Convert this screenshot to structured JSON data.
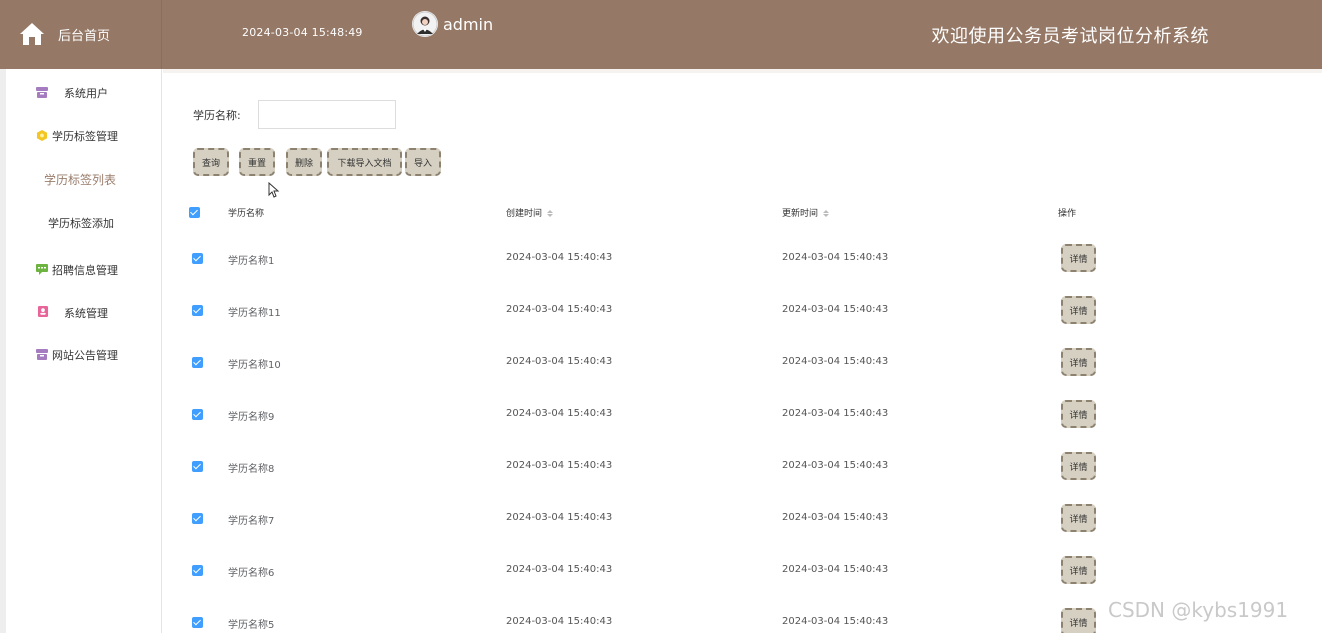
{
  "header": {
    "home_label": "后台首页",
    "datetime": "2024-03-04 15:48:49",
    "username": "admin",
    "welcome": "欢迎使用公务员考试岗位分析系统",
    "bg_color": "#957866"
  },
  "sidebar": {
    "items": [
      {
        "label": "系统用户",
        "icon": "box-icon",
        "icon_color": "#a57cc0"
      },
      {
        "label": "学历标签管理",
        "icon": "hexagon-icon",
        "icon_color": "#f3c623"
      },
      {
        "label": "学历标签列表",
        "sub": true,
        "active": true
      },
      {
        "label": "学历标签添加",
        "sub": true
      },
      {
        "label": "招聘信息管理",
        "icon": "chat-icon",
        "icon_color": "#6db33f"
      },
      {
        "label": "系统管理",
        "icon": "id-card-icon",
        "icon_color": "#e8659a"
      },
      {
        "label": "网站公告管理",
        "icon": "box-icon",
        "icon_color": "#a57cc0"
      }
    ]
  },
  "search": {
    "label": "学历名称:",
    "value": "",
    "placeholder": ""
  },
  "toolbar": {
    "query": "查询",
    "reset": "重置",
    "delete": "删除",
    "download_template": "下载导入文档",
    "import": "导入"
  },
  "table": {
    "columns": {
      "name": "学历名称",
      "created": "创建时间",
      "updated": "更新时间",
      "actions": "操作"
    },
    "detail_label": "详情",
    "rows": [
      {
        "name": "学历名称1",
        "created": "2024-03-04 15:40:43",
        "updated": "2024-03-04 15:40:43"
      },
      {
        "name": "学历名称11",
        "created": "2024-03-04 15:40:43",
        "updated": "2024-03-04 15:40:43"
      },
      {
        "name": "学历名称10",
        "created": "2024-03-04 15:40:43",
        "updated": "2024-03-04 15:40:43"
      },
      {
        "name": "学历名称9",
        "created": "2024-03-04 15:40:43",
        "updated": "2024-03-04 15:40:43"
      },
      {
        "name": "学历名称8",
        "created": "2024-03-04 15:40:43",
        "updated": "2024-03-04 15:40:43"
      },
      {
        "name": "学历名称7",
        "created": "2024-03-04 15:40:43",
        "updated": "2024-03-04 15:40:43"
      },
      {
        "name": "学历名称6",
        "created": "2024-03-04 15:40:43",
        "updated": "2024-03-04 15:40:43"
      },
      {
        "name": "学历名称5",
        "created": "2024-03-04 15:40:43",
        "updated": "2024-03-04 15:40:43"
      }
    ]
  },
  "watermark": "CSDN @kybs1991",
  "colors": {
    "accent": "#9a7d6c",
    "checkbox": "#409eff",
    "button_bg": "#d6d0c2",
    "button_border": "#8d8270"
  }
}
